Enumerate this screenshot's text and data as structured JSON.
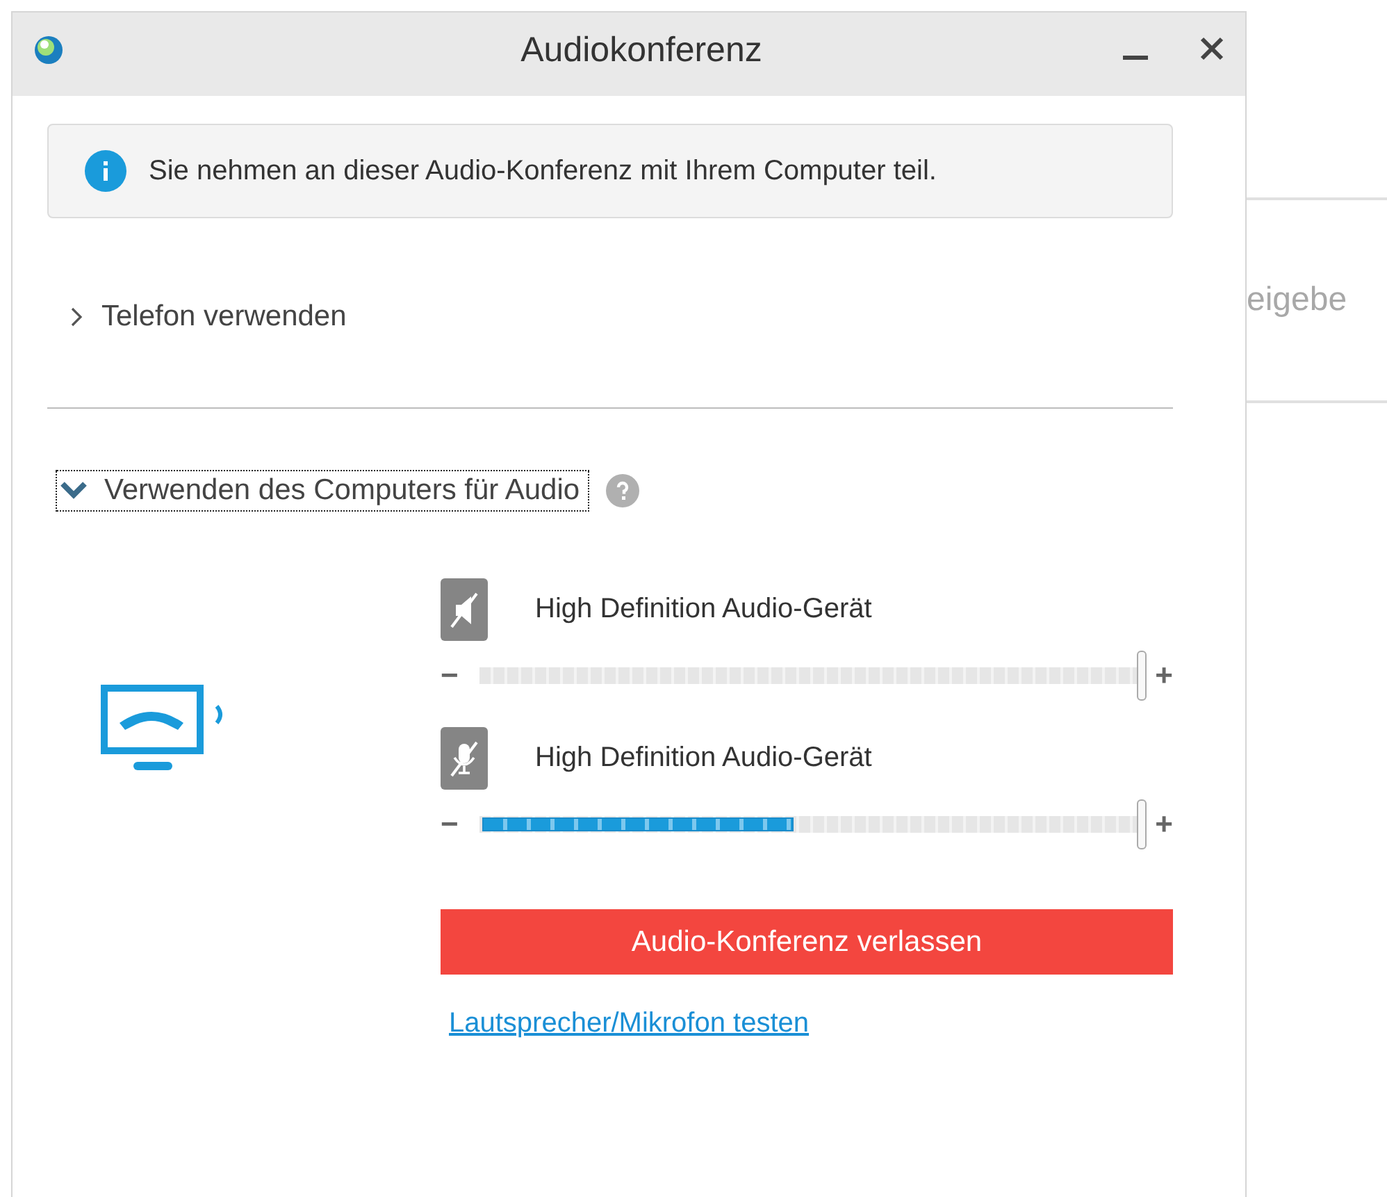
{
  "window": {
    "title": "Audiokonferenz"
  },
  "info": {
    "text": "Sie nehmen an dieser Audio-Konferenz mit Ihrem Computer teil."
  },
  "sections": [
    {
      "label": "Telefon verwenden",
      "expanded": false
    },
    {
      "label": "Verwenden des Computers für Audio",
      "expanded": true
    }
  ],
  "devices": [
    {
      "kind": "speaker",
      "muted": true,
      "name": "High Definition Audio-Gerät",
      "minus": "−",
      "plus": "+",
      "volume": {
        "level": 1
      }
    },
    {
      "kind": "microphone",
      "muted": true,
      "name": "High Definition Audio-Gerät",
      "minus": "−",
      "plus": "+",
      "volume": {
        "level": 1
      },
      "meter": {
        "level": 0.47
      }
    }
  ],
  "leave_button": "Audio-Konferenz verlassen",
  "test_link": "Lautsprecher/Mikrofon testen",
  "background_panel": {
    "text": "eigebe"
  }
}
